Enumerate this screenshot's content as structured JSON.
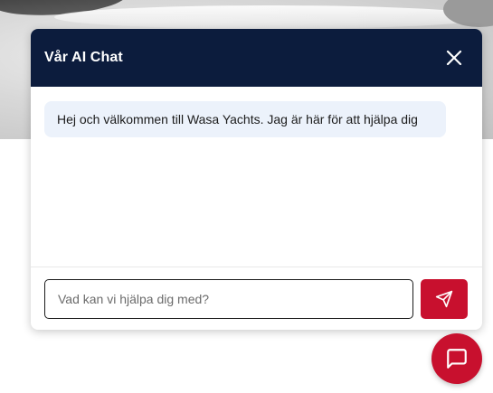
{
  "chat": {
    "title": "Vår AI Chat",
    "close_icon": "close-icon",
    "messages": [
      {
        "role": "assistant",
        "text": "Hej och välkommen till Wasa Yachts. Jag är här för att hjälpa dig"
      }
    ],
    "input": {
      "placeholder": "Vad kan vi hjälpa dig med?",
      "value": ""
    },
    "send_icon": "send-icon"
  },
  "launcher": {
    "icon": "chat-bubble-icon"
  },
  "colors": {
    "header_bg": "#0c1c3d",
    "accent_red": "#c8102e",
    "bubble_bg": "#ecf2fb"
  }
}
